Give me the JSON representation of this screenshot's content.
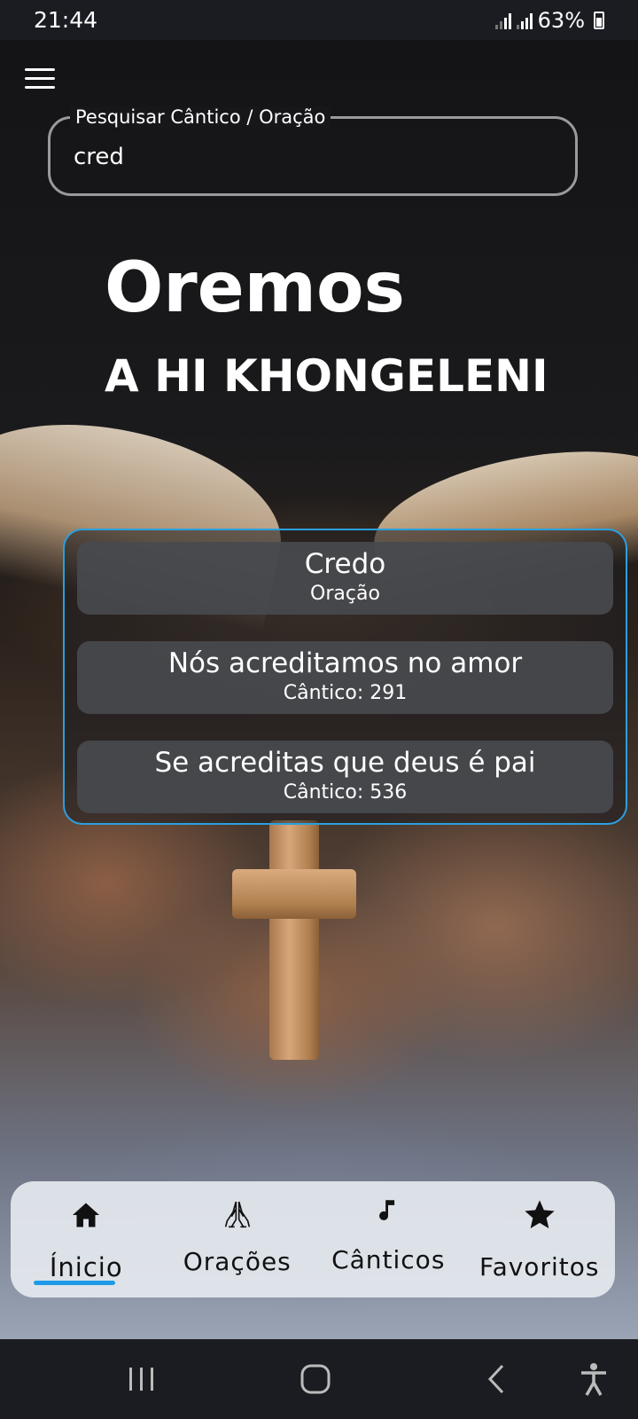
{
  "status_bar": {
    "time": "21:44",
    "battery": "63%"
  },
  "search": {
    "label": "Pesquisar Cântico / Oração",
    "value": "cred"
  },
  "header": {
    "title": "Oremos",
    "subtitle": "A HI KHONGELENI"
  },
  "results": [
    {
      "title": "Credo",
      "subtitle": "Oração"
    },
    {
      "title": "Nós acreditamos no amor",
      "subtitle": "Cântico: 291"
    },
    {
      "title": "Se acreditas que deus é pai",
      "subtitle": "Cântico: 536"
    }
  ],
  "bottom_nav": {
    "items": [
      {
        "label": "Ínicio",
        "icon": "home-icon",
        "active": true
      },
      {
        "label": "Orações",
        "icon": "praying-hands-icon",
        "active": false
      },
      {
        "label": "Cânticos",
        "icon": "music-note-icon",
        "active": false
      },
      {
        "label": "Favoritos",
        "icon": "star-icon",
        "active": false
      }
    ]
  },
  "colors": {
    "accent": "#1e9be8",
    "results_border": "#2aa0e0",
    "nav_background": "#e4e8ee",
    "system_bar": "#1b1c22"
  }
}
